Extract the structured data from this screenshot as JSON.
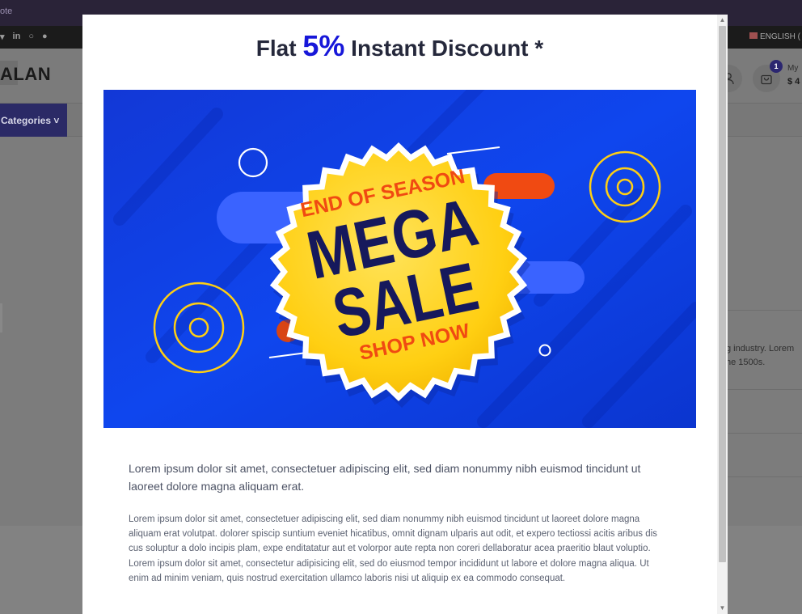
{
  "background": {
    "topbar_text": "ote",
    "social_icons": [
      "twitter-icon",
      "linkedin-icon",
      "whatsapp-icon",
      "pinterest-icon"
    ],
    "social_glyphs": [
      "▾",
      "in",
      "○",
      "●"
    ],
    "language": "ENGLISH (",
    "brand": "ALAN",
    "cart": {
      "badge_count": "1",
      "label": "My",
      "total": "$ 4"
    },
    "categories_button": "Categories ˅",
    "right_panel": {
      "line1": "g industry. Lorem",
      "line2": "he 1500s."
    }
  },
  "modal": {
    "title_prefix": "Flat ",
    "title_percent": "5%",
    "title_suffix": " Instant Discount *",
    "banner": {
      "top_text": "END OF SEASON",
      "main_line1": "MEGA",
      "main_line2": "SALE",
      "bottom_text": "SHOP NOW"
    },
    "intro": "Lorem ipsum dolor sit amet, consectetuer adipiscing elit, sed diam nonummy nibh euismod tincidunt ut laoreet dolore magna aliquam erat.",
    "body": "Lorem ipsum dolor sit amet, consectetuer adipiscing elit, sed diam nonummy nibh euismod tincidunt ut laoreet dolore magna aliquam erat volutpat. dolorer spiscip suntium eveniet hicatibus, omnit dignam ulparis aut odit, et expero tectiossi acitis aribus dis cus soluptur a dolo incipis plam, expe enditatatur aut et volorpor aute repta non coreri dellaboratur acea praeritio blaut voluptio. Lorem ipsum dolor sit amet, consectetur adipisicing elit, sed do eiusmod tempor incididunt ut labore et dolore magna aliqua. Ut enim ad minim veniam, quis nostrud exercitation ullamco laboris nisi ut aliquip ex ea commodo consequat."
  },
  "colors": {
    "accent_blue": "#1717d9",
    "banner_blue": "#0f3fe0",
    "sale_yellow": "#ffd21a",
    "sale_orange": "#f04a12",
    "sale_navy": "#16195c"
  }
}
